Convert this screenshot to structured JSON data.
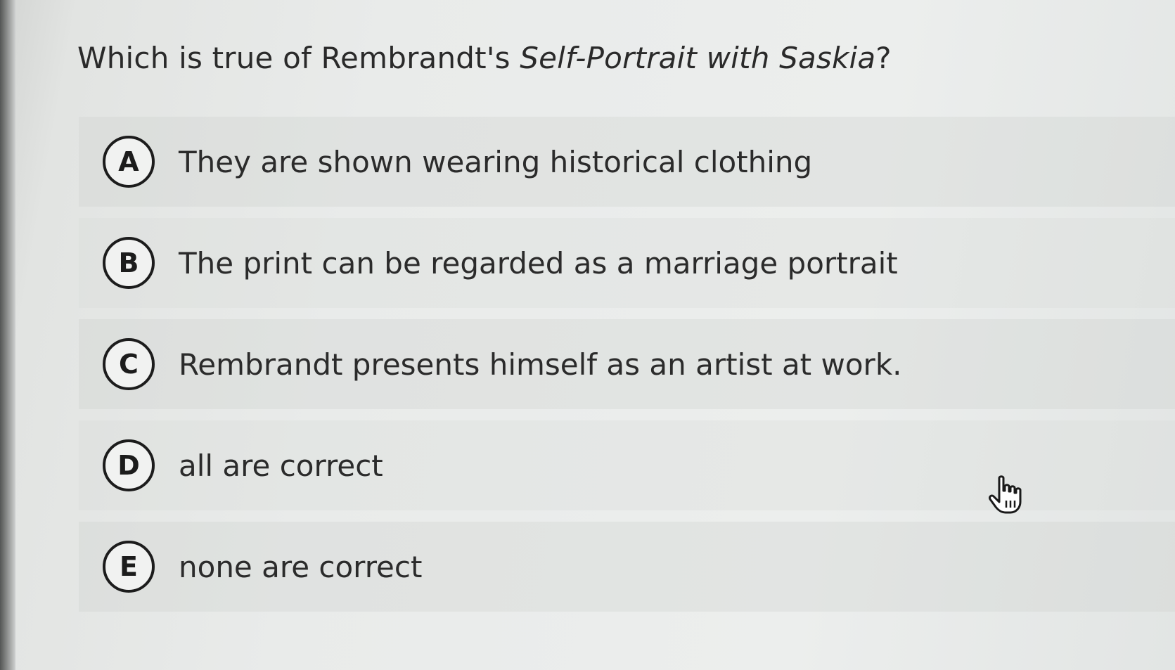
{
  "question": {
    "prefix": "Which is true of Rembrandt's ",
    "work_title": "Self-Portrait with Saskia",
    "suffix": "?"
  },
  "options": [
    {
      "letter": "A",
      "text": "They are shown wearing historical clothing"
    },
    {
      "letter": "B",
      "text": "The print can be regarded as a marriage portrait"
    },
    {
      "letter": "C",
      "text": "Rembrandt presents himself as an artist at work."
    },
    {
      "letter": "D",
      "text": "all are correct"
    },
    {
      "letter": "E",
      "text": "none are correct"
    }
  ],
  "cursor": {
    "icon": "hand-pointer-icon"
  }
}
